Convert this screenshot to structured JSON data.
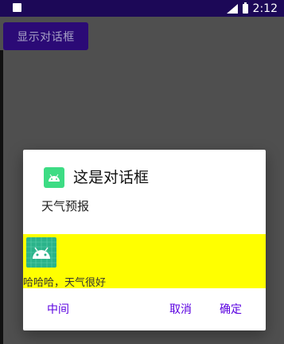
{
  "status_bar": {
    "time": "2:12",
    "icons": [
      "notification-icon",
      "signal-icon",
      "battery-icon"
    ]
  },
  "app": {
    "show_dialog_button": "显示对话框"
  },
  "dialog": {
    "title": "这是对话框",
    "message": "天气预报",
    "custom_view_text": "哈哈哈，天气很好",
    "buttons": {
      "neutral": "中间",
      "negative": "取消",
      "positive": "确定"
    },
    "accent_color": "#5a00e0",
    "panel_color": "#ffff00"
  }
}
